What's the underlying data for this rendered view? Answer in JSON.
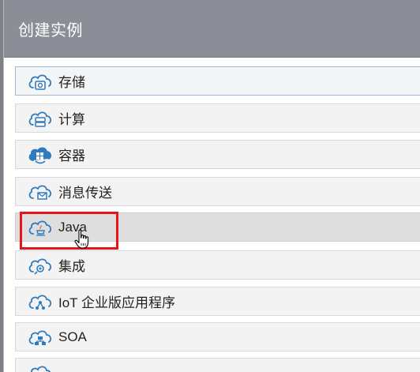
{
  "dialog": {
    "title": "创建实例"
  },
  "colors": {
    "header_bg": "#8b8e96",
    "icon_blue": "#2f7bbf",
    "highlight_red": "#e5151b",
    "hover_bg": "#dedede"
  },
  "items": [
    {
      "label": "存储",
      "icon": "cloud-storage-icon",
      "state": "focused"
    },
    {
      "label": "计算",
      "icon": "cloud-compute-icon",
      "state": "normal"
    },
    {
      "label": "容器",
      "icon": "cloud-container-icon",
      "state": "normal"
    },
    {
      "label": "消息传送",
      "icon": "cloud-messaging-icon",
      "state": "normal"
    },
    {
      "label": "Java",
      "icon": "cloud-java-icon",
      "state": "hovered"
    },
    {
      "label": "集成",
      "icon": "cloud-integration-icon",
      "state": "normal"
    },
    {
      "label": "IoT 企业版应用程序",
      "icon": "cloud-iot-icon",
      "state": "normal"
    },
    {
      "label": "SOA",
      "icon": "cloud-soa-icon",
      "state": "normal"
    },
    {
      "label": "",
      "icon": "cloud-icon",
      "state": "partially-visible"
    }
  ]
}
